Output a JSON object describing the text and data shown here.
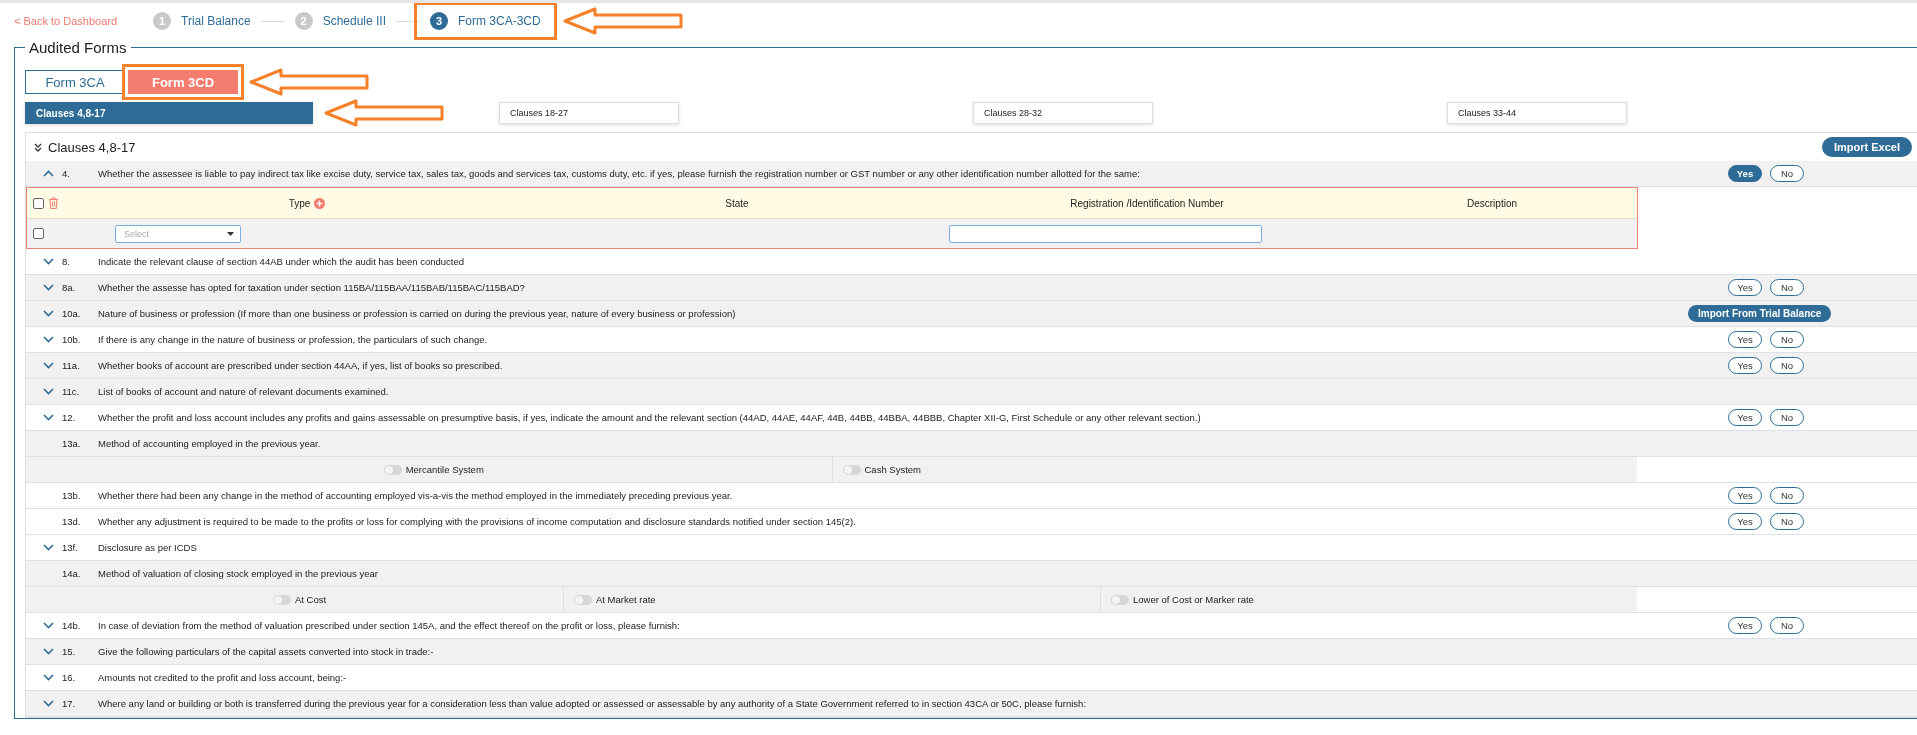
{
  "back_link": "< Back to Dashboard",
  "steps": [
    {
      "number": "1",
      "label": "Trial Balance",
      "selected": false
    },
    {
      "number": "2",
      "label": "Schedule III",
      "selected": false
    },
    {
      "number": "3",
      "label": "Form 3CA-3CD",
      "selected": true,
      "annotated": true
    }
  ],
  "legend": "Audited Forms",
  "form_tabs": [
    {
      "label": "Form 3CA",
      "selected": false
    },
    {
      "label": "Form 3CD",
      "selected": true,
      "annotated": true
    }
  ],
  "clause_tabs": [
    {
      "label": "Clauses 4,8-17",
      "selected": true,
      "annotated": true
    },
    {
      "label": "Clauses 18-27",
      "selected": false
    },
    {
      "label": "Clauses 28-32",
      "selected": false
    },
    {
      "label": "Clauses 33-44",
      "selected": false
    }
  ],
  "panel": {
    "title": "Clauses 4,8-17",
    "expanded": true,
    "import_button": "Import Excel"
  },
  "rows": [
    {
      "kind": "question",
      "expanded": true,
      "shaded": true,
      "number": "4.",
      "text": "Whether the assessee is liable to pay indirect tax like excise duty, service tax, sales tax, goods and services tax, customs duty, etc. if yes, please furnish the registration number or GST number or any other identification number allotted for the same:",
      "answers": [
        {
          "label": "Yes",
          "selected": true
        },
        {
          "label": "No",
          "selected": false
        }
      ]
    },
    {
      "kind": "table",
      "columns": [
        "Type",
        "State",
        "Registration /Identification Number",
        "Description"
      ],
      "row": {
        "checked": false,
        "select_placeholder": "Select"
      },
      "header_checked": false
    },
    {
      "kind": "question",
      "expanded": false,
      "shaded": false,
      "number": "8.",
      "text": "Indicate the relevant clause of section 44AB under which the audit has been conducted"
    },
    {
      "kind": "question",
      "expanded": false,
      "shaded": true,
      "number": "8a.",
      "text": "Whether the assesse has opted for taxation under section 115BA/115BAA/115BAB/115BAC/115BAD?",
      "answers": [
        {
          "label": "Yes",
          "selected": false
        },
        {
          "label": "No",
          "selected": false
        }
      ]
    },
    {
      "kind": "question",
      "expanded": false,
      "shaded": true,
      "number": "10a.",
      "text": "Nature of business or profession (If more than one business or profession is carried on during the previous year, nature of every business or profession)",
      "action": "Import From Trial Balance"
    },
    {
      "kind": "question",
      "expanded": false,
      "shaded": false,
      "number": "10b.",
      "text": "If there is any change in the nature of business or profession, the particulars of such change.",
      "answers": [
        {
          "label": "Yes",
          "selected": false
        },
        {
          "label": "No",
          "selected": false
        }
      ]
    },
    {
      "kind": "question",
      "expanded": false,
      "shaded": true,
      "number": "11a.",
      "text": "Whether books of account are prescribed under section 44AA, if yes, list of books so prescribed.",
      "answers": [
        {
          "label": "Yes",
          "selected": false
        },
        {
          "label": "No",
          "selected": false
        }
      ]
    },
    {
      "kind": "question",
      "expanded": false,
      "shaded": true,
      "number": "11c.",
      "text": "List of books of account and nature of relevant documents examined."
    },
    {
      "kind": "question",
      "expanded": false,
      "shaded": false,
      "number": "12.",
      "text": "Whether the profit and loss account includes any profits and gains assessable on presumptive basis, if yes, indicate the amount and the relevant section (44AD, 44AE, 44AF, 44B, 44BB, 44BBA, 44BBB, Chapter XII-G, First Schedule or any other relevant section.)",
      "answers": [
        {
          "label": "Yes",
          "selected": false
        },
        {
          "label": "No",
          "selected": false
        }
      ]
    },
    {
      "kind": "question",
      "shaded": true,
      "number": "13a.",
      "text": "Method of accounting employed in the previous year."
    },
    {
      "kind": "options",
      "options": [
        {
          "label": "Mercantile System",
          "on": false
        },
        {
          "label": "Cash System",
          "on": false
        }
      ]
    },
    {
      "kind": "question",
      "shaded": false,
      "number": "13b.",
      "text": "Whether there had been any change in the method of accounting employed vis-a-vis the method employed in the immediately preceding previous year.",
      "answers": [
        {
          "label": "Yes",
          "selected": false
        },
        {
          "label": "No",
          "selected": false
        }
      ]
    },
    {
      "kind": "question",
      "shaded": false,
      "number": "13d.",
      "text": "Whether any adjustment is required to be made to the profits or loss for complying with the provisions of income computation and disclosure standards notified under section 145(2).",
      "answers": [
        {
          "label": "Yes",
          "selected": false
        },
        {
          "label": "No",
          "selected": false
        }
      ]
    },
    {
      "kind": "question",
      "expanded": false,
      "shaded": false,
      "number": "13f.",
      "text": "Disclosure as per ICDS"
    },
    {
      "kind": "question",
      "shaded": true,
      "number": "14a.",
      "text": "Method of valuation of closing stock employed in the previous year"
    },
    {
      "kind": "options",
      "options": [
        {
          "label": "At Cost",
          "on": false
        },
        {
          "label": "At Market rate",
          "on": false
        },
        {
          "label": "Lower of Cost or Marker rate",
          "on": false
        }
      ]
    },
    {
      "kind": "question",
      "expanded": false,
      "shaded": false,
      "number": "14b.",
      "text": "In case of deviation from the method of valuation prescribed under section 145A, and the effect thereof on the profit or loss, please furnish:",
      "answers": [
        {
          "label": "Yes",
          "selected": false
        },
        {
          "label": "No",
          "selected": false
        }
      ]
    },
    {
      "kind": "question",
      "expanded": false,
      "shaded": true,
      "number": "15.",
      "text": "Give the following particulars of the capital assets converted into stock in trade:-"
    },
    {
      "kind": "question",
      "expanded": false,
      "shaded": false,
      "number": "16.",
      "text": "Amounts not credited to the profit and loss account, being:-"
    },
    {
      "kind": "question",
      "expanded": false,
      "shaded": true,
      "number": "17.",
      "text": "Where any land or building or both is transferred during the previous year for a consideration less than value adopted or assessed or assessable by any authority of a State Government referred to in section 43CA or 50C, please furnish:"
    }
  ]
}
